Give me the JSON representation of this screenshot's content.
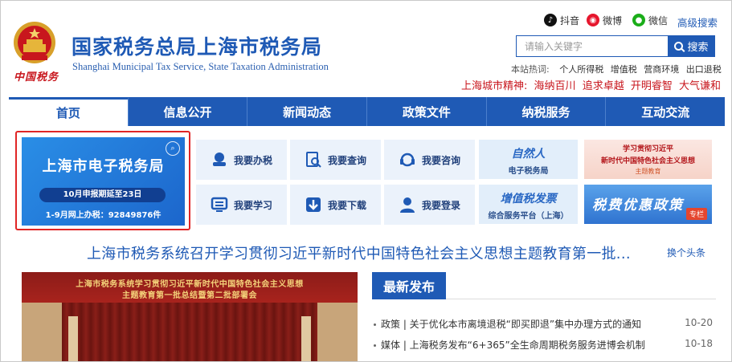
{
  "header": {
    "emblem_text": "中国税务",
    "title": "国家税务总局上海市税务局",
    "subtitle": "Shanghai Municipal Tax Service, State Taxation Administration"
  },
  "social": {
    "douyin": "抖音",
    "weibo": "微博",
    "wechat": "微信",
    "advanced_search": "高级搜索"
  },
  "search": {
    "placeholder": "请输入关键字",
    "button_label": "搜索"
  },
  "hot": {
    "label": "本站热词:",
    "items": [
      "个人所得税",
      "增值税",
      "营商环境",
      "出口退税"
    ]
  },
  "spirit": {
    "label": "上海城市精神:",
    "items": [
      "海纳百川",
      "追求卓越",
      "开明睿智",
      "大气谦和"
    ]
  },
  "nav": {
    "items": [
      "首页",
      "信息公开",
      "新闻动态",
      "政策文件",
      "纳税服务",
      "互动交流"
    ]
  },
  "etax": {
    "title": "上海市电子税务局",
    "notice": "10月申报期延至23日",
    "count_text": "1-9月网上办税：92849876件"
  },
  "services": {
    "items": [
      "我要办税",
      "我要查询",
      "我要咨询",
      "我要学习",
      "我要下载",
      "我要登录"
    ]
  },
  "banners": {
    "ziran_title": "自然人",
    "ziran_sub": "电子税务局",
    "theme_line1": "学习贯彻习近平",
    "theme_line2": "新时代中国特色社会主义思想",
    "theme_line3": "主题教育",
    "vat_title": "增值税发票",
    "vat_sub": "综合服务平台（上海）",
    "pref_title": "税费优惠政策",
    "pref_tag": "专栏"
  },
  "headline": {
    "text": "上海市税务系统召开学习贯彻习近平新时代中国特色社会主义思想主题教育第一批...",
    "switch": "换个头条"
  },
  "photo": {
    "banner_line1": "上海市税务系统学习贯彻习近平新时代中国特色社会主义思想",
    "banner_line2": "主题教育第一批总结暨第二批部署会"
  },
  "latest": {
    "tab_label": "最新发布",
    "items": [
      {
        "text": "政策 | 关于优化本市离境退税“即买即退”集中办理方式的通知",
        "date": "10-20"
      },
      {
        "text": "媒体 | 上海税务发布“6+365”全生命周期税务服务进博会机制",
        "date": "10-18"
      }
    ]
  },
  "colors": {
    "brand_blue": "#1f5ab5",
    "accent_red": "#c8161d"
  }
}
